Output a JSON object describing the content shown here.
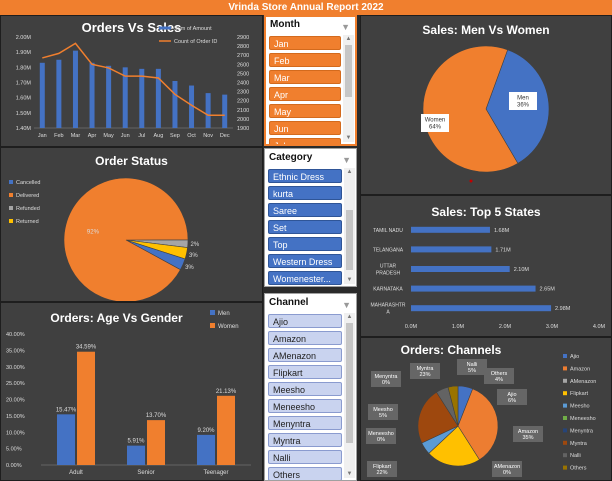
{
  "banner": "Vrinda Store Annual Report 2022",
  "colors": {
    "orange": "#f07f2e",
    "blue": "#4472c4",
    "panel": "#404040",
    "yellow": "#ffc000",
    "gray": "#a5a5a5"
  },
  "orders_vs_sales": {
    "title": "Orders Vs Sales",
    "legend": [
      "Sum of Amount",
      "Count of Order ID"
    ],
    "left_ticks": [
      "2.00M",
      "1.90M",
      "1.80M",
      "1.70M",
      "1.60M",
      "1.50M",
      "1.40M"
    ],
    "right_ticks": [
      "2900",
      "2800",
      "2700",
      "2600",
      "2500",
      "2400",
      "2300",
      "2200",
      "2100",
      "2000",
      "1900"
    ],
    "chart_data": {
      "type": "bar+line",
      "categories": [
        "Jan",
        "Feb",
        "Mar",
        "Apr",
        "May",
        "Jun",
        "Jul",
        "Aug",
        "Sep",
        "Oct",
        "Nov",
        "Dec"
      ],
      "series": [
        {
          "name": "Sum of Amount",
          "axis": "left",
          "values": [
            1.83,
            1.85,
            1.91,
            1.83,
            1.81,
            1.8,
            1.79,
            1.79,
            1.71,
            1.68,
            1.63,
            1.62
          ]
        },
        {
          "name": "Count of Order ID",
          "axis": "right",
          "values": [
            2670,
            2720,
            2830,
            2600,
            2560,
            2470,
            2470,
            2450,
            2270,
            2150,
            2040,
            2040
          ]
        }
      ],
      "ylim_left": [
        1.4,
        2.0
      ],
      "ylim_right": [
        1900,
        2900
      ]
    }
  },
  "order_status": {
    "title": "Order Status",
    "chart_data": {
      "type": "pie",
      "labels": [
        "Cancelled",
        "Delivered",
        "Refunded",
        "Returned"
      ],
      "values": [
        3,
        92,
        2,
        3
      ],
      "data_labels": [
        "3%",
        "92%",
        "2%",
        "3%"
      ]
    }
  },
  "age_gender": {
    "title": "Orders: Age Vs Gender",
    "y_ticks": [
      "40.00%",
      "35.00%",
      "30.00%",
      "25.00%",
      "20.00%",
      "15.00%",
      "10.00%",
      "5.00%",
      "0.00%"
    ],
    "legend": [
      "Men",
      "Women"
    ],
    "chart_data": {
      "type": "bar",
      "categories": [
        "Adult",
        "Senior",
        "Teenager"
      ],
      "series": [
        {
          "name": "Men",
          "values": [
            15.47,
            5.91,
            9.2
          ],
          "labels": [
            "15.47%",
            "5.91%",
            "9.20%"
          ]
        },
        {
          "name": "Women",
          "values": [
            34.59,
            13.7,
            21.13
          ],
          "labels": [
            "34.59%",
            "13.70%",
            "21.13%"
          ]
        }
      ],
      "ylim": [
        0,
        40
      ]
    }
  },
  "slicers": {
    "month": {
      "title": "Month",
      "items": [
        "Jan",
        "Feb",
        "Mar",
        "Apr",
        "May",
        "Jun",
        "Jul"
      ]
    },
    "category": {
      "title": "Category",
      "items": [
        "Ethnic Dress",
        "kurta",
        "Saree",
        "Set",
        "Top",
        "Western Dress",
        "Womenester..."
      ]
    },
    "channel": {
      "title": "Channel",
      "items": [
        "Ajio",
        "Amazon",
        "AMenazon",
        "Flipkart",
        "Meesho",
        "Meneesho",
        "Menyntra",
        "Myntra",
        "Nalli",
        "Others"
      ]
    }
  },
  "men_women": {
    "title": "Sales: Men Vs Women",
    "chart_data": {
      "type": "pie",
      "labels": [
        "Men",
        "Women"
      ],
      "values": [
        36,
        64
      ],
      "data_labels": [
        "36%",
        "64%"
      ]
    }
  },
  "top_states": {
    "title": "Sales: Top 5 States",
    "x_ticks": [
      "0.0M",
      "1.0M",
      "2.0M",
      "3.0M",
      "4.0M"
    ],
    "chart_data": {
      "type": "bar",
      "categories": [
        "TAMIL NADU",
        "TELANGANA",
        "UTTAR PRADESH",
        "KARNATAKA",
        "MAHARASHTRA"
      ],
      "category_lines": [
        [
          "TAMIL NADU"
        ],
        [
          "TELANGANA"
        ],
        [
          "UTTAR",
          "PRADESH"
        ],
        [
          "KARNATAKA"
        ],
        [
          "MAHARASHTR",
          "A"
        ]
      ],
      "values": [
        1.68,
        1.71,
        2.1,
        2.65,
        2.98
      ],
      "data_labels": [
        "1.68M",
        "1.71M",
        "2.10M",
        "2.65M",
        "2.98M"
      ],
      "xlim": [
        0,
        4
      ]
    }
  },
  "channels": {
    "title": "Orders: Channels",
    "chart_data": {
      "type": "pie",
      "labels": [
        "Ajio",
        "Amazon",
        "AMenazon",
        "Flipkart",
        "Meesho",
        "Meneesho",
        "Menyntra",
        "Myntra",
        "Nalli",
        "Others"
      ],
      "values": [
        6,
        35,
        0,
        22,
        5,
        0,
        0,
        23,
        5,
        4
      ],
      "data_labels": [
        "6%",
        "35%",
        "0%",
        "22%",
        "5%",
        "0%",
        "0%",
        "23%",
        "5%",
        "4%"
      ]
    }
  }
}
